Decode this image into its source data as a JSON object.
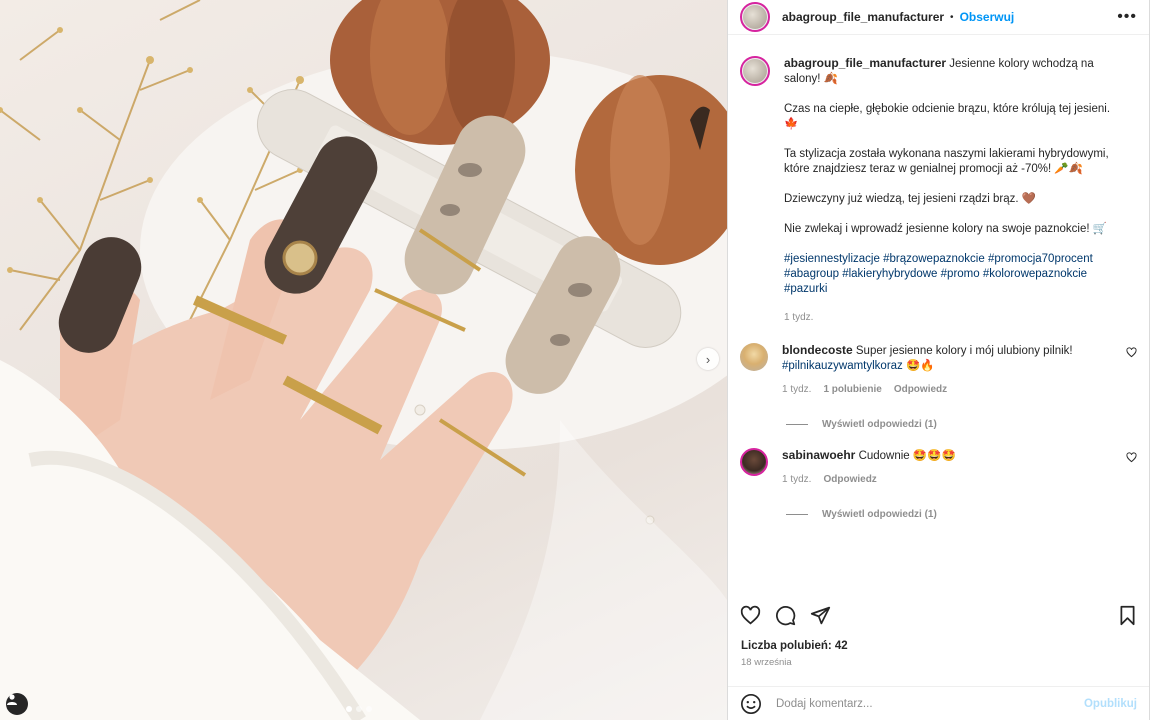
{
  "post": {
    "username": "abagroup_file_manufacturer",
    "follow_label": "Obserwuj",
    "more_label": "•••",
    "caption": {
      "username": "abagroup_file_manufacturer",
      "line1": "Jesienne kolory wchodzą na salony! 🍂",
      "line2": "Czas na ciepłe, głębokie odcienie brązu, które królują tej jesieni. 🍁",
      "line3": "Ta stylizacja została wykonana naszymi lakierami hybrydowymi, które znajdziesz teraz w genialnej promocji aż -70%! 🥕🍂",
      "line4": "Dziewczyny już wiedzą, tej jesieni rządzi brąz. 🤎",
      "line5": "Nie zwlekaj i wprowadź jesienne kolory na swoje paznokcie! 🛒",
      "hashtags": [
        "#jesiennestylizacje",
        "#brązowepaznokcie",
        "#promocja70procent",
        "#abagroup",
        "#lakieryhybrydowe",
        "#promo",
        "#kolorowepaznokcie",
        "#pazurki"
      ],
      "time": "1 tydz."
    },
    "comments": [
      {
        "username": "blondecoste",
        "text": "Super jesienne kolory i mój ulubiony pilnik!",
        "tag": "#pilnikauzywamtylkoraz",
        "emoji": "🤩🔥",
        "time": "1 tydz.",
        "likes": "1 polubienie",
        "reply": "Odpowiedz",
        "replies": "Wyświetl odpowiedzi (1)"
      },
      {
        "username": "sabinawoehr",
        "text": "Cudownie 🤩🤩🤩",
        "time": "1 tydz.",
        "reply": "Odpowiedz",
        "replies": "Wyświetl odpowiedzi (1)"
      }
    ],
    "likes_label": "Liczba polubień: 42",
    "date": "18 września",
    "add_comment_placeholder": "Dodaj komentarz...",
    "publish_label": "Opublikuj"
  },
  "icons": {
    "heart": "heart-icon",
    "comment": "comment-icon",
    "share": "share-icon",
    "save": "bookmark-icon",
    "emoji": "emoji-icon",
    "next": "chevron-right-icon",
    "user_tag": "user-tag-icon"
  },
  "colors": {
    "follow": "#0095f6",
    "hashtag": "#00376b",
    "muted": "#8e8e8e",
    "publish_disabled": "#b2dffc"
  }
}
